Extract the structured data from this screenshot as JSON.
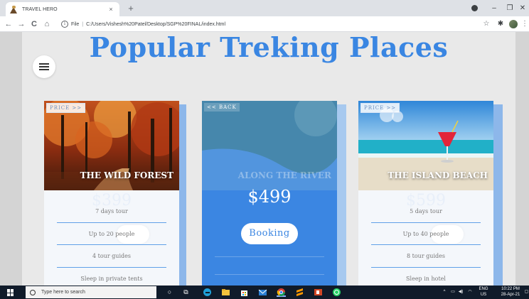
{
  "browser": {
    "tab_title": "TRAVEL HERO",
    "tab_close": "×",
    "new_tab": "+",
    "window_controls": {
      "minimize": "–",
      "restore": "❐",
      "close": "✕"
    },
    "nav": {
      "back": "←",
      "forward": "→",
      "reload": "C",
      "home": "⌂"
    },
    "url_scheme": "File",
    "url_path": "C:/Users/Vishesh%20Patel/Desktop/SGP%20FINAL/index.html",
    "bookmark_star": "☆",
    "extension_icon": "✱",
    "menu": "⋮"
  },
  "page": {
    "heading": "Popular Treking Places",
    "colors": {
      "accent": "#3a86e2",
      "shadow": "#8db7ea",
      "divider": "#5fa0e8"
    },
    "cards": [
      {
        "tag": "PRICE >>",
        "title": "THE WILD FOREST",
        "ghost_price": "$399",
        "features": [
          "7 days tour",
          "Up to 20 people",
          "4 tour guides",
          "Sleep in private tents"
        ]
      },
      {
        "tag": "<< BACK",
        "ghost_title": "ALONG THE RIVER",
        "price": "$499",
        "button": "Booking"
      },
      {
        "tag": "PRICE >>",
        "title": "THE ISLAND BEACH",
        "ghost_price": "$599",
        "features": [
          "5 days tour",
          "Up to 40 people",
          "8 tour guides",
          "Sleep in hotel"
        ]
      }
    ]
  },
  "taskbar": {
    "search_placeholder": "Type here to search",
    "tray": {
      "chevron": "^",
      "lang_top": "ENG",
      "lang_bottom": "US"
    },
    "time": "10:22 PM",
    "date": "28-Apr-21"
  }
}
